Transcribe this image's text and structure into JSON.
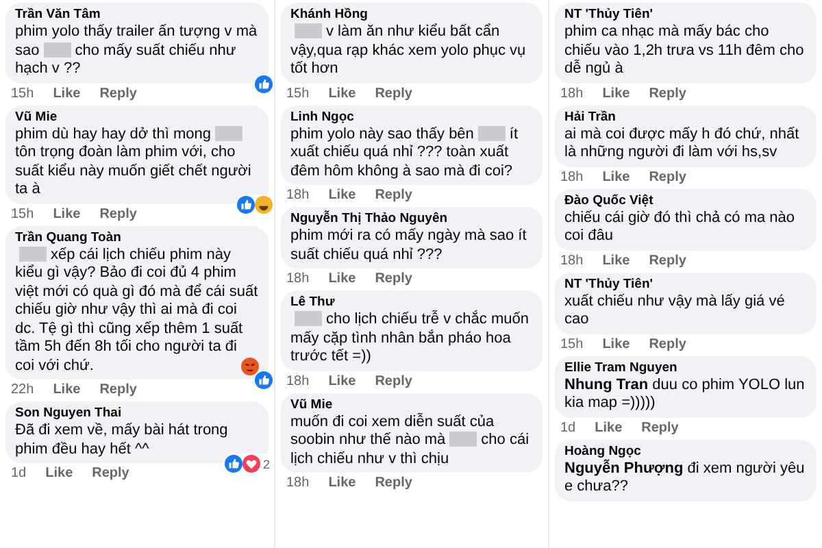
{
  "columns": [
    {
      "comments": [
        {
          "name": "Trần Văn Tâm",
          "parts": [
            {
              "kind": "text",
              "text": "phim yolo thấy trailer ấn tượng v mà sao"
            },
            {
              "kind": "blur"
            },
            {
              "kind": "text",
              "text": "cho mấy suất chiếu như hạch v ??"
            }
          ],
          "time": "15h",
          "like": "Like",
          "reply": "Reply",
          "reactions": [
            {
              "kind": "like"
            }
          ]
        },
        {
          "name": "Vũ Mie",
          "parts": [
            {
              "kind": "text",
              "text": "phim dù hay hay dở thì mong"
            },
            {
              "kind": "blur"
            },
            {
              "kind": "text",
              "text": "tôn trọng đoàn làm phim với, cho suất kiểu này muốn giết chết người ta à"
            }
          ],
          "time": "15h",
          "like": "Like",
          "reply": "Reply",
          "reactions": [
            {
              "kind": "like"
            },
            {
              "kind": "haha"
            }
          ]
        },
        {
          "name": "Trần Quang Toàn",
          "parts": [
            {
              "kind": "blur"
            },
            {
              "kind": "text",
              "text": "xếp cái lịch chiếu phim này kiểu gì vậy? Bảo đi coi đủ 4 phim việt mới có quà gì đó mà để cái suất chiếu giờ như vậy thì ai mà đi coi dc. Tệ gì thì cũng xếp thêm 1 suất tầm 5h đến 8h tối cho người ta đi coi với chứ."
            }
          ],
          "emoji": {
            "kind": "angry"
          },
          "time": "22h",
          "like": "Like",
          "reply": "Reply",
          "reactions": [
            {
              "kind": "like"
            }
          ]
        },
        {
          "name": "Son Nguyen Thai",
          "parts": [
            {
              "kind": "text",
              "text": "Đã đi xem về, mấy bài hát trong phim đều hay hết ^^"
            }
          ],
          "time": "1d",
          "like": "Like",
          "reply": "Reply",
          "reactions": [
            {
              "kind": "like"
            },
            {
              "kind": "love"
            }
          ],
          "count": "2"
        }
      ]
    },
    {
      "comments": [
        {
          "name": "Khánh Hồng",
          "parts": [
            {
              "kind": "blur"
            },
            {
              "kind": "text",
              "text": "v làm ăn như kiểu bất cẩn vậy,qua rạp khác xem yolo phục vụ tốt hơn"
            }
          ],
          "time": "15h",
          "like": "Like",
          "reply": "Reply"
        },
        {
          "name": "Linh Ngọc",
          "parts": [
            {
              "kind": "text",
              "text": "phim yolo này sao thấy bên"
            },
            {
              "kind": "blur"
            },
            {
              "kind": "text",
              "text": "ít xuất chiếu quá nhỉ ??? toàn xuất đêm hôm không à sao mà đi coi?"
            }
          ],
          "time": "18h",
          "like": "Like",
          "reply": "Reply"
        },
        {
          "name": "Nguyễn Thị Thảo Nguyên",
          "parts": [
            {
              "kind": "text",
              "text": "phim mới ra có mấy ngày mà sao ít suất chiếu quá nhỉ ???"
            }
          ],
          "time": "18h",
          "like": "Like",
          "reply": "Reply"
        },
        {
          "name": "Lê Thư",
          "parts": [
            {
              "kind": "blur"
            },
            {
              "kind": "text",
              "text": "cho lịch chiếu trễ v chắc muốn mấy cặp tình nhân bắn pháo hoa trước tết =))"
            }
          ],
          "time": "18h",
          "like": "Like",
          "reply": "Reply"
        },
        {
          "name": "Vũ Mie",
          "parts": [
            {
              "kind": "text",
              "text": "muốn đi coi xem diễn suất của soobin như thế nào mà"
            },
            {
              "kind": "blur"
            },
            {
              "kind": "text",
              "text": "cho cái lịch chiếu như v thì chịu"
            }
          ],
          "time": "18h",
          "like": "Like",
          "reply": "Reply"
        }
      ]
    },
    {
      "comments": [
        {
          "name": "NT 'Thủy Tiên'",
          "parts": [
            {
              "kind": "text",
              "text": "phim ca nhạc mà mấy bác cho chiếu vào 1,2h trưa vs 11h đêm cho dễ ngủ à"
            }
          ],
          "time": "18h",
          "like": "Like",
          "reply": "Reply"
        },
        {
          "name": "Hải Trần",
          "parts": [
            {
              "kind": "text",
              "text": "ai mà coi được mấy h đó chứ, nhất là những người đi làm với hs,sv"
            }
          ],
          "time": "18h",
          "like": "Like",
          "reply": "Reply"
        },
        {
          "name": "Đào Quốc Việt",
          "parts": [
            {
              "kind": "text",
              "text": "chiếu cái giờ đó thì chả có ma nào coi đâu"
            }
          ],
          "time": "18h",
          "like": "Like",
          "reply": "Reply"
        },
        {
          "name": "NT 'Thủy Tiên'",
          "parts": [
            {
              "kind": "text",
              "text": "xuất chiếu như vậy mà lấy giá vé cao"
            }
          ],
          "time": "15h",
          "like": "Like",
          "reply": "Reply"
        },
        {
          "name": "Ellie Tram Nguyen",
          "parts": [
            {
              "kind": "text",
              "text": "**Nhung Tran** duu co phim YOLO lun kia map =)))))"
            }
          ],
          "time": "1d",
          "like": "Like",
          "reply": "Reply"
        },
        {
          "name": "Hoàng Ngọc",
          "parts": [
            {
              "kind": "text",
              "text": "**Nguyễn Phượng** đi xem người yêu e chưa??"
            }
          ]
        }
      ]
    }
  ]
}
